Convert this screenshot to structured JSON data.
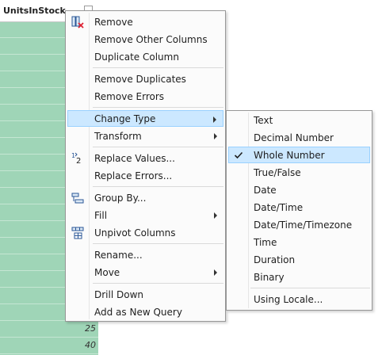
{
  "column": {
    "header": "UnitsInStock",
    "visible_values": [
      "25",
      "40"
    ]
  },
  "context_menu": {
    "items": [
      {
        "label": "Remove",
        "icon": "remove-column-icon"
      },
      {
        "label": "Remove Other Columns"
      },
      {
        "label": "Duplicate Column"
      },
      {
        "label": "Remove Duplicates"
      },
      {
        "label": "Remove Errors"
      },
      {
        "label": "Change Type",
        "has_submenu": true,
        "highlighted": true
      },
      {
        "label": "Transform",
        "has_submenu": true
      },
      {
        "label": "Replace Values...",
        "icon": "replace-values-icon"
      },
      {
        "label": "Replace Errors..."
      },
      {
        "label": "Group By...",
        "icon": "group-by-icon"
      },
      {
        "label": "Fill",
        "has_submenu": true
      },
      {
        "label": "Unpivot Columns",
        "icon": "unpivot-icon"
      },
      {
        "label": "Rename..."
      },
      {
        "label": "Move",
        "has_submenu": true
      },
      {
        "label": "Drill Down"
      },
      {
        "label": "Add as New Query"
      }
    ]
  },
  "change_type_submenu": {
    "items": [
      {
        "label": "Text"
      },
      {
        "label": "Decimal Number"
      },
      {
        "label": "Whole Number",
        "checked": true,
        "highlighted": true
      },
      {
        "label": "True/False"
      },
      {
        "label": "Date"
      },
      {
        "label": "Date/Time"
      },
      {
        "label": "Date/Time/Timezone"
      },
      {
        "label": "Time"
      },
      {
        "label": "Duration"
      },
      {
        "label": "Binary"
      },
      {
        "label": "Using Locale..."
      }
    ]
  },
  "colors": {
    "column_fill": "#9fd5b7",
    "highlight": "#cce8ff",
    "highlight_border": "#99d1ff",
    "check": "#1e1e1e"
  }
}
